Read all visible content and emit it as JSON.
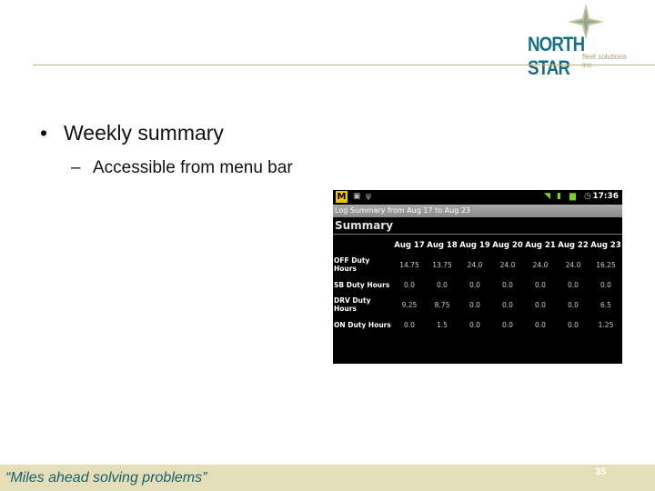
{
  "logo": {
    "name": "NORTH STAR",
    "subtitle": "fleet solutions inc."
  },
  "slide": {
    "bullets": [
      {
        "text": "Weekly summary",
        "marker": "•"
      },
      {
        "text": "Accessible from menu bar",
        "marker": "–"
      }
    ]
  },
  "phone": {
    "status": {
      "app_icon": "M",
      "time": "17:36"
    },
    "title": "Log Summary from Aug 17 to Aug 23",
    "heading": "Summary",
    "table": {
      "columns": [
        "Aug 17",
        "Aug 18",
        "Aug 19",
        "Aug 20",
        "Aug 21",
        "Aug 22",
        "Aug 23"
      ],
      "rows": [
        {
          "label": "OFF Duty Hours",
          "values": [
            "14.75",
            "13.75",
            "24.0",
            "24.0",
            "24.0",
            "24.0",
            "16.25"
          ]
        },
        {
          "label": "SB Duty Hours",
          "values": [
            "0.0",
            "0.0",
            "0.0",
            "0.0",
            "0.0",
            "0.0",
            "0.0"
          ]
        },
        {
          "label": "DRV Duty Hours",
          "values": [
            "9.25",
            "8.75",
            "0.0",
            "0.0",
            "0.0",
            "0.0",
            "6.5"
          ]
        },
        {
          "label": "ON Duty Hours",
          "values": [
            "0.0",
            "1.5",
            "0.0",
            "0.0",
            "0.0",
            "0.0",
            "1.25"
          ]
        }
      ]
    }
  },
  "footer": {
    "tagline": "“Miles ahead solving problems”",
    "page_number": "35"
  }
}
